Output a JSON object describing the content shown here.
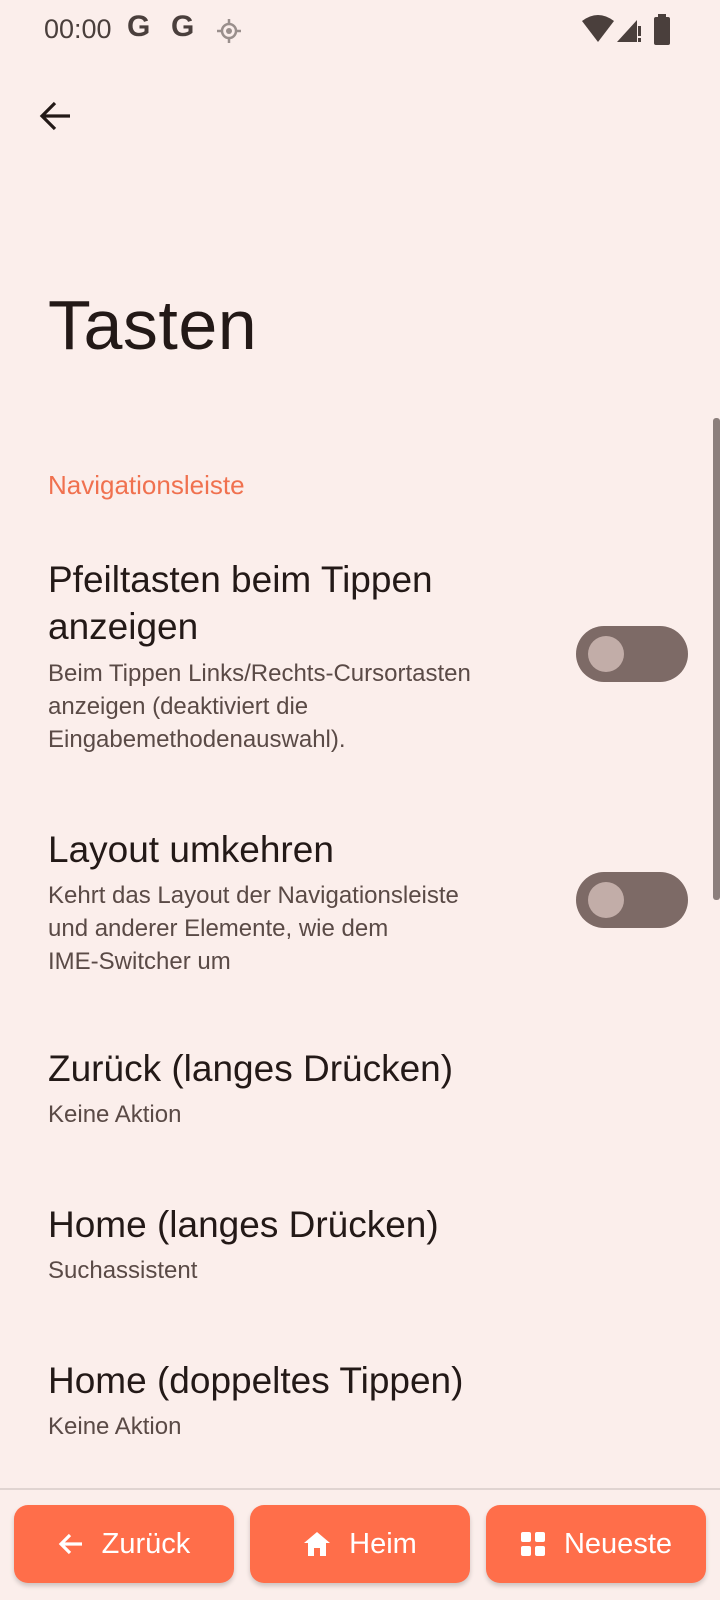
{
  "status_bar": {
    "time": "00:00",
    "icons": [
      "google-icon",
      "google-icon",
      "location-icon",
      "wifi-icon",
      "signal-icon",
      "battery-icon"
    ]
  },
  "page": {
    "title": "Tasten"
  },
  "section": {
    "header": "Navigationsleiste"
  },
  "preferences": [
    {
      "title_line1": "Pfeiltasten beim Tippen",
      "title_line2": "anzeigen",
      "summary_line1": "Beim Tippen Links/Rechts-Cursortasten",
      "summary_line2": "anzeigen (deaktiviert die",
      "summary_line3": "Eingabemethodenauswahl).",
      "switch_on": false
    },
    {
      "title_line1": "Layout umkehren",
      "summary_line1": "Kehrt das Layout der Navigationsleiste",
      "summary_line2": "und anderer Elemente, wie dem",
      "summary_line3": "IME-Switcher um",
      "switch_on": false
    },
    {
      "title_line1": "Zurück (langes Drücken)",
      "summary_line1": "Keine Aktion"
    },
    {
      "title_line1": "Home (langes Drücken)",
      "summary_line1": "Suchassistent"
    },
    {
      "title_line1": "Home (doppeltes Tippen)",
      "summary_line1": "Keine Aktion"
    }
  ],
  "bottom_nav": {
    "back_label": "Zurück",
    "home_label": "Heim",
    "recent_label": "Neueste"
  },
  "colors": {
    "background": "#FBEEEB",
    "accent": "#F0714F",
    "button": "#FF6E4A",
    "switch_track": "#7d6a66"
  }
}
